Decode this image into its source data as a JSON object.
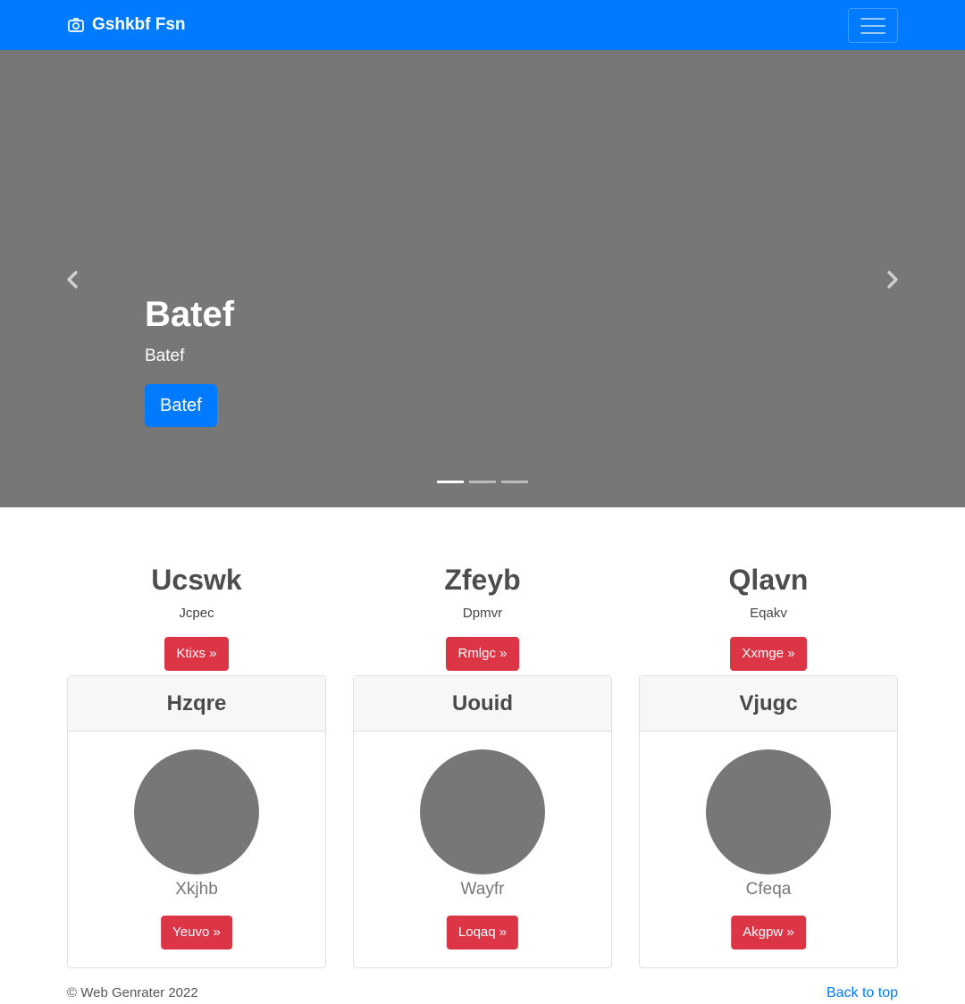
{
  "navbar": {
    "brand": "Gshkbf Fsn",
    "brand_icon": "camera-icon",
    "toggler_icon": "hamburger-menu-icon",
    "bg_color": "#007bff"
  },
  "carousel": {
    "bg_color": "#777777",
    "slide_title": "Batef",
    "slide_text": "Batef",
    "slide_button": "Batef",
    "prev_icon": "chevron-left-icon",
    "next_icon": "chevron-right-icon",
    "indicator_count": 3,
    "active_indicator": 1
  },
  "features": [
    {
      "title": "Ucswk",
      "text": "Jcpec",
      "button": "Ktixs »"
    },
    {
      "title": "Zfeyb",
      "text": "Dpmvr",
      "button": "Rmlgc »"
    },
    {
      "title": "Qlavn",
      "text": "Eqakv",
      "button": "Xxmge »"
    }
  ],
  "cards": [
    {
      "header": "Hzqre",
      "name": "Xkjhb",
      "button": "Yeuvo »"
    },
    {
      "header": "Uouid",
      "name": "Wayfr",
      "button": "Loqaq »"
    },
    {
      "header": "Vjugc",
      "name": "Cfeqa",
      "button": "Akgpw »"
    }
  ],
  "footer": {
    "copyright": "© Web Genrater 2022",
    "back_to_top": "Back to top"
  },
  "colors": {
    "primary": "#007bff",
    "danger": "#dc3545",
    "placeholder_gray": "#777777"
  }
}
